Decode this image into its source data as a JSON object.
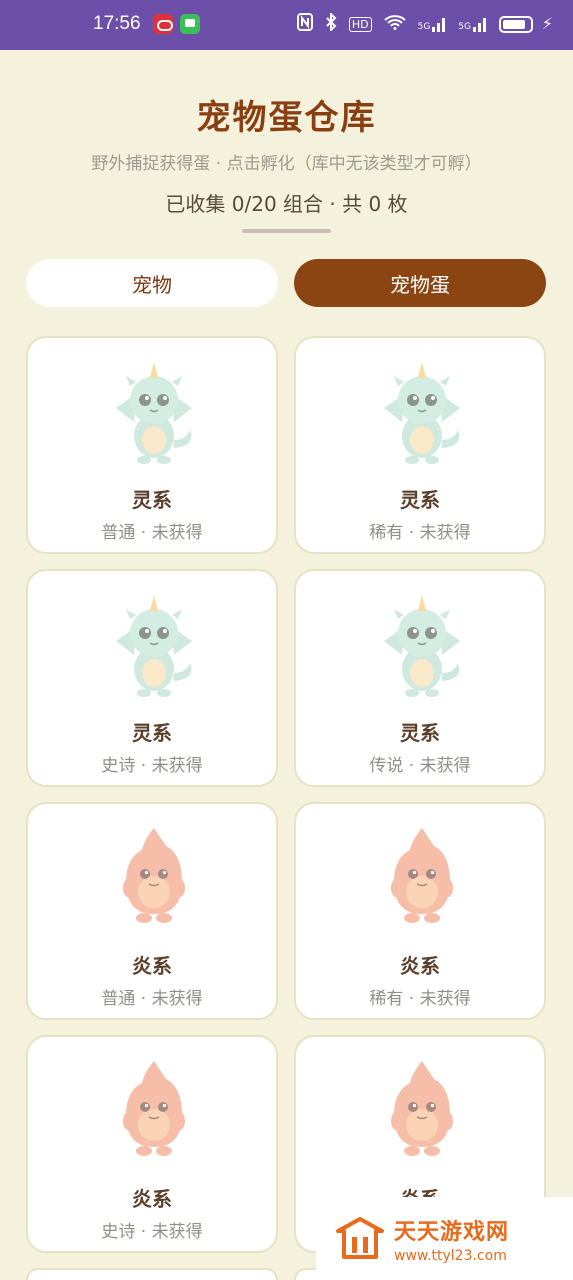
{
  "status_bar": {
    "time": "17:56",
    "hd": "HD",
    "signal1": "5G",
    "signal2": "5G"
  },
  "header": {
    "title": "宠物蛋仓库",
    "subtitle": "野外捕捉获得蛋 · 点击孵化（库中无该类型才可孵）",
    "collected": "已收集 0/20 组合 · 共 0 枚"
  },
  "tabs": [
    {
      "label": "宠物",
      "active": false
    },
    {
      "label": "宠物蛋",
      "active": true
    }
  ],
  "cards": [
    {
      "name": "灵系",
      "meta": "普通 · 未获得",
      "creature": "dragon-icon"
    },
    {
      "name": "灵系",
      "meta": "稀有 · 未获得",
      "creature": "dragon-icon"
    },
    {
      "name": "灵系",
      "meta": "史诗 · 未获得",
      "creature": "dragon-icon"
    },
    {
      "name": "灵系",
      "meta": "传说 · 未获得",
      "creature": "dragon-icon"
    },
    {
      "name": "炎系",
      "meta": "普通 · 未获得",
      "creature": "flame-creature-icon"
    },
    {
      "name": "炎系",
      "meta": "稀有 · 未获得",
      "creature": "flame-creature-icon"
    },
    {
      "name": "炎系",
      "meta": "史诗 · 未获得",
      "creature": "flame-creature-icon"
    },
    {
      "name": "炎系",
      "meta": "",
      "creature": "flame-creature-icon"
    }
  ],
  "watermark": {
    "title": "天天游戏网",
    "url": "www.ttyl23.com"
  },
  "colors": {
    "background": "#f4f2dc",
    "accent": "#8b4513",
    "title": "#8a3f12",
    "status_bar": "#6b4fa8",
    "card_border": "#e6e2c4",
    "watermark": "#e86a1b"
  }
}
